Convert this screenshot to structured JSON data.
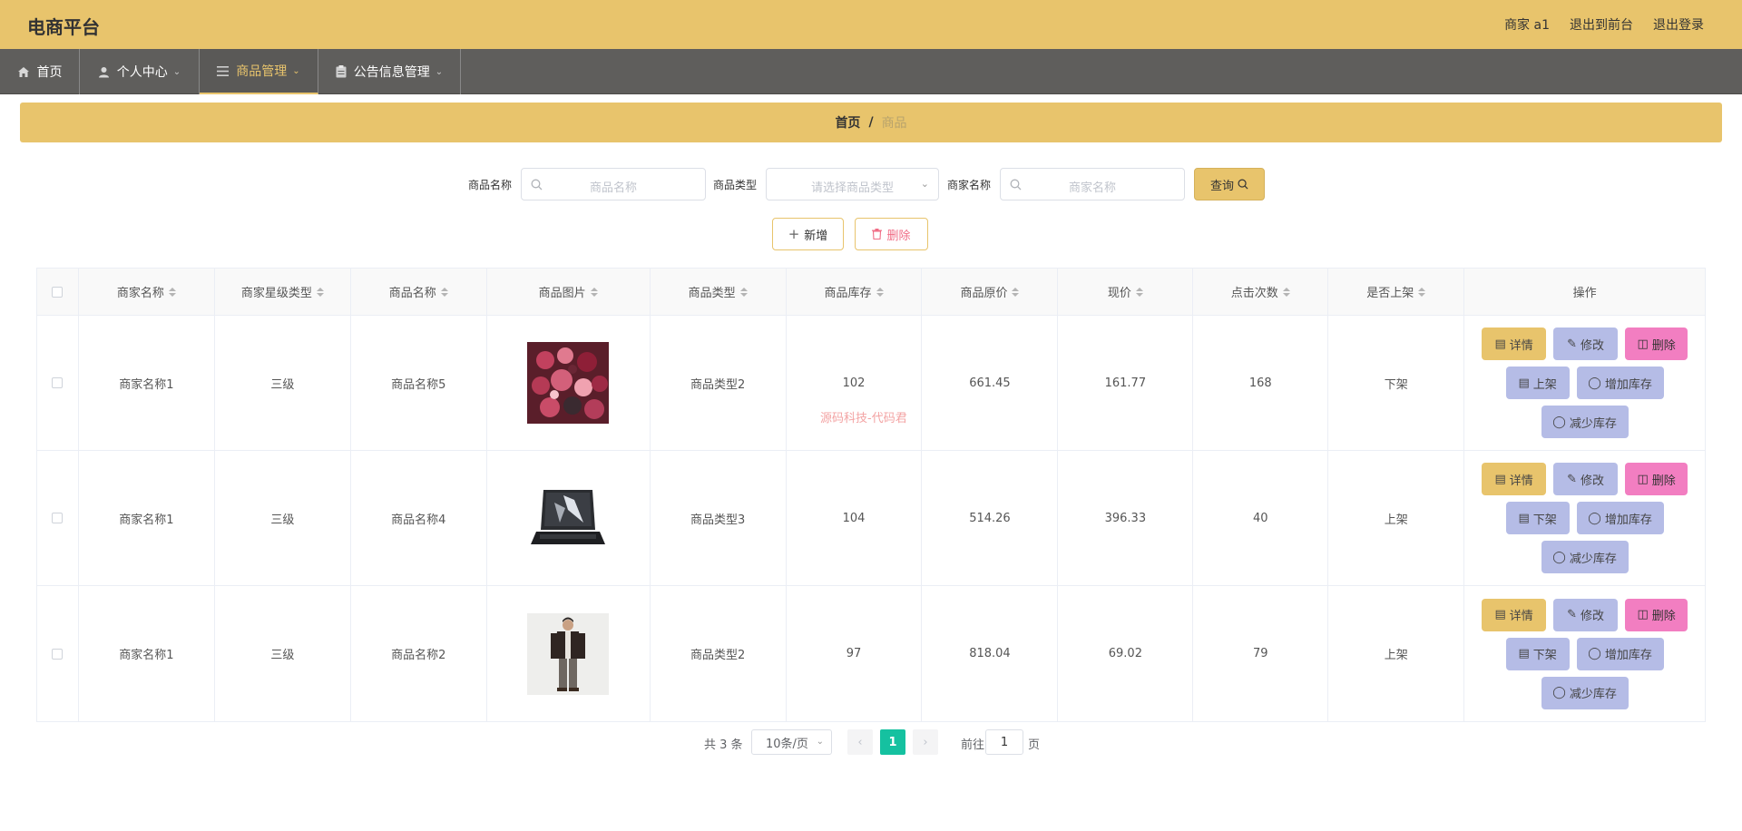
{
  "app": {
    "title": "电商平台"
  },
  "top_links": [
    "商家 a1",
    "退出到前台",
    "退出登录"
  ],
  "nav": [
    {
      "label": "首页",
      "icon": "home-icon"
    },
    {
      "label": "个人中心",
      "icon": "user-icon"
    },
    {
      "label": "商品管理",
      "icon": "menu-icon"
    },
    {
      "label": "公告信息管理",
      "icon": "clipboard-icon"
    }
  ],
  "breadcrumb": {
    "home": "首页",
    "separator": "/",
    "current": "商品"
  },
  "search": {
    "name_label": "商品名称",
    "name_placeholder": "商品名称",
    "type_label": "商品类型",
    "type_placeholder": "请选择商品类型",
    "merchant_label": "商家名称",
    "merchant_placeholder": "商家名称",
    "query_label": "查询"
  },
  "actions": {
    "add_label": "新增",
    "delete_label": "删除"
  },
  "table": {
    "headers": [
      "商家名称",
      "商家星级类型",
      "商品名称",
      "商品图片",
      "商品类型",
      "商品库存",
      "商品原价",
      "现价",
      "点击次数",
      "是否上架",
      "操作"
    ],
    "rows": [
      {
        "merchant": "商家名称1",
        "star": "三级",
        "name": "商品名称5",
        "image": "flower-bouquet",
        "type": "商品类型2",
        "stock": "102",
        "original_price": "661.45",
        "price": "161.77",
        "clicks": "168",
        "on_shelf": "下架",
        "toggle_label": "上架"
      },
      {
        "merchant": "商家名称1",
        "star": "三级",
        "name": "商品名称4",
        "image": "laptop",
        "type": "商品类型3",
        "stock": "104",
        "original_price": "514.26",
        "price": "396.33",
        "clicks": "40",
        "on_shelf": "上架",
        "toggle_label": "下架"
      },
      {
        "merchant": "商家名称1",
        "star": "三级",
        "name": "商品名称2",
        "image": "man-in-jacket",
        "type": "商品类型2",
        "stock": "97",
        "original_price": "818.04",
        "price": "69.02",
        "clicks": "79",
        "on_shelf": "上架",
        "toggle_label": "下架"
      }
    ],
    "op_labels": {
      "detail": "详情",
      "edit": "修改",
      "delete": "删除",
      "add_stock": "增加库存",
      "reduce_stock": "减少库存"
    }
  },
  "watermark": "源码科技-代码君",
  "pagination": {
    "total_text": "共 3 条",
    "page_size": "10条/页",
    "current_page": "1",
    "goto_label": "前往",
    "goto_value": "1",
    "page_unit": "页"
  },
  "colors": {
    "accent": "#e8c46c",
    "nav_bg": "#5f5e5c",
    "pager_active": "#15c1a0",
    "edit_btn": "#b5bce6",
    "delete_btn": "#f27ec1"
  }
}
